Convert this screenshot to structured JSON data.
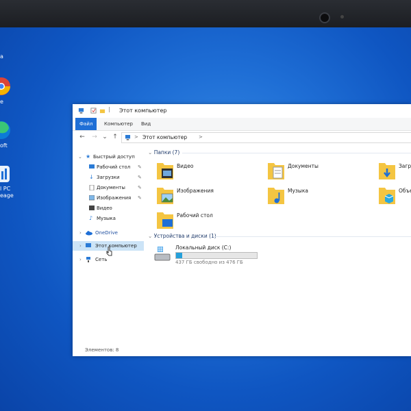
{
  "desktop": {
    "icons": [
      {
        "name": "chrome-icon",
        "label": "e"
      },
      {
        "name": "edge-icon",
        "label": "oft"
      },
      {
        "name": "pc-health-icon",
        "label": "l PC\neage"
      }
    ],
    "top_label": "a"
  },
  "window": {
    "title": "Этот компьютер",
    "ribbon_tabs": [
      "Файл",
      "Компьютер",
      "Вид"
    ],
    "address_path": "Этот компьютер",
    "nav": {
      "back": "←",
      "forward": "→",
      "dropdown": "⌄",
      "up": "↑",
      "sep": ">"
    }
  },
  "sidebar": {
    "quick_access": "Быстрый доступ",
    "quick_items": [
      {
        "label": "Рабочий стол",
        "pinned": true
      },
      {
        "label": "Загрузки",
        "pinned": true
      },
      {
        "label": "Документы",
        "pinned": true
      },
      {
        "label": "Изображения",
        "pinned": true
      },
      {
        "label": "Видео",
        "pinned": false
      },
      {
        "label": "Музыка",
        "pinned": false
      }
    ],
    "onedrive": "OneDrive",
    "this_pc": "Этот компьютер",
    "network": "Сеть"
  },
  "content": {
    "folders_header": "Папки (7)",
    "folders": [
      {
        "label": "Видео",
        "icon": "video-folder-icon"
      },
      {
        "label": "Документы",
        "icon": "documents-folder-icon"
      },
      {
        "label": "Загру",
        "icon": "downloads-folder-icon"
      },
      {
        "label": "Изображения",
        "icon": "pictures-folder-icon"
      },
      {
        "label": "Музыка",
        "icon": "music-folder-icon"
      },
      {
        "label": "Объем",
        "icon": "3d-objects-folder-icon"
      },
      {
        "label": "Рабочий стол",
        "icon": "desktop-folder-icon"
      }
    ],
    "devices_header": "Устройства и диски (1)",
    "drive": {
      "name": "Локальный диск (C:)",
      "free_text": "437 ГБ свободно из 476 ГБ",
      "used_fraction": 0.08
    }
  },
  "status": {
    "items": "Элементов: 8"
  },
  "colors": {
    "accent": "#1f6fd6",
    "selection": "#cce4f7",
    "folder": "#f4c542",
    "drive_fill": "#26a0da"
  }
}
